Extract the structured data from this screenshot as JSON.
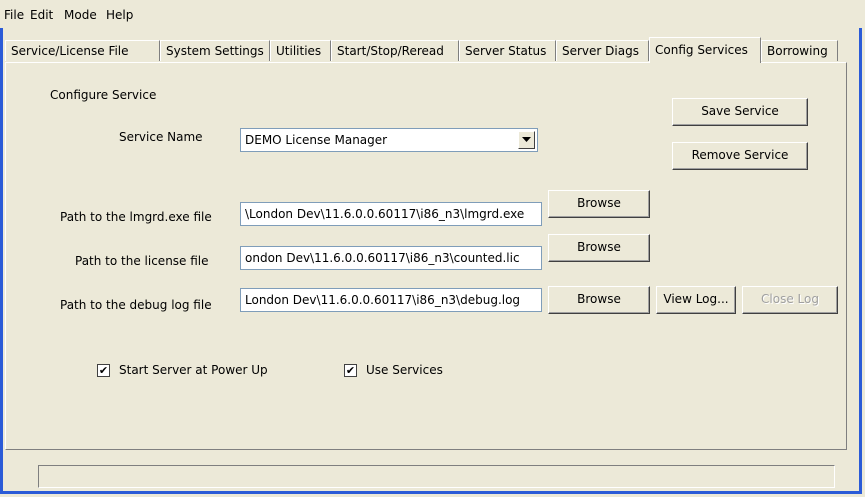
{
  "menu": [
    "File",
    "Edit",
    "Mode",
    "Help"
  ],
  "tabs": [
    "Service/License File",
    "System Settings",
    "Utilities",
    "Start/Stop/Reread",
    "Server Status",
    "Server Diags",
    "Config Services",
    "Borrowing"
  ],
  "active_tab": "Config Services",
  "section_title": "Configure Service",
  "service_name": {
    "label": "Service Name",
    "value": "DEMO License Manager"
  },
  "lmgrd_path": {
    "label": "Path to the lmgrd.exe file",
    "value": "\\London Dev\\11.6.0.0.60117\\i86_n3\\lmgrd.exe"
  },
  "license_path": {
    "label": "Path to the license file",
    "value": "ondon Dev\\11.6.0.0.60117\\i86_n3\\counted.lic"
  },
  "debug_path": {
    "label": "Path to the debug log file",
    "value": "London Dev\\11.6.0.0.60117\\i86_n3\\debug.log"
  },
  "buttons": {
    "save": "Save Service",
    "remove": "Remove Service",
    "browse": "Browse",
    "view_log": "View Log...",
    "close_log": "Close Log"
  },
  "checkboxes": {
    "start_at_power_up": {
      "label": "Start Server at Power Up",
      "checked": true
    },
    "use_services": {
      "label": "Use Services",
      "checked": true
    }
  },
  "colors": {
    "background": "#ece9d8",
    "frame": "#2b5bd7",
    "disabled_text": "#a0a0a0"
  }
}
